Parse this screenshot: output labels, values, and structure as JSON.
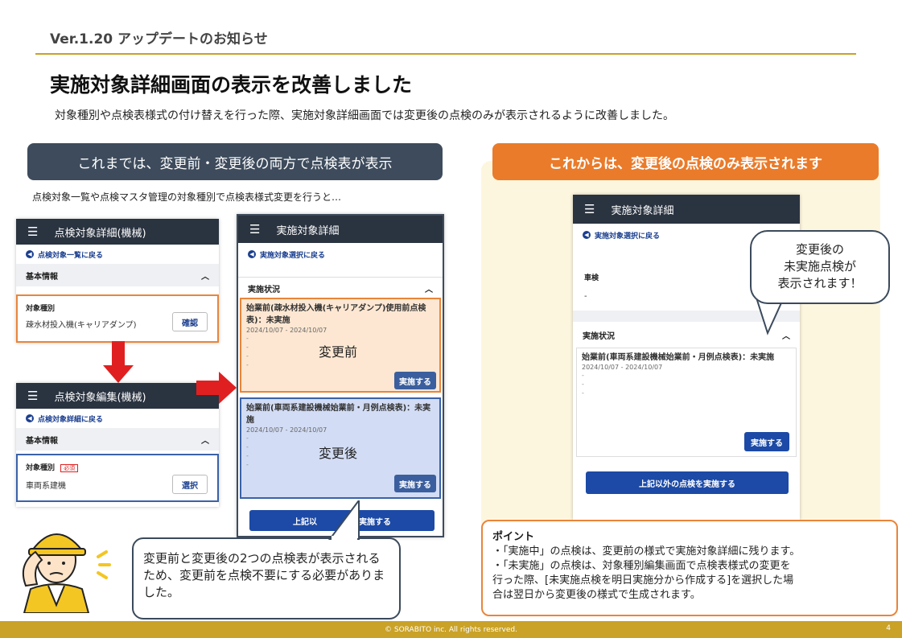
{
  "header": {
    "version": "Ver.1.20 アップデートのお知らせ",
    "title": "実施対象詳細画面の表示を改善しました",
    "subtitle": "対象種別や点検表様式の付け替えを行った際、実施対象詳細画面では変更後の点検のみが表示されるように改善しました。"
  },
  "left": {
    "header": "これまでは、変更前・変更後の両方で点検表が表示",
    "desc": "点検対象一覧や点検マスタ管理の対象種別で点検表様式変更を行うと…",
    "screen1": {
      "app_title": "点検対象詳細(機械)",
      "back": "点検対象一覧に戻る",
      "section": "基本情報",
      "field_label": "対象種別",
      "field_value": "疎水材投入機(キャリアダンプ)",
      "button": "確認"
    },
    "screen2": {
      "app_title": "点検対象編集(機械)",
      "back": "点検対象詳細に戻る",
      "section": "基本情報",
      "field_label": "対象種別",
      "required": "必須",
      "field_value": "車両系建機",
      "button": "選択"
    },
    "screen3": {
      "app_title": "実施対象詳細",
      "back": "実施対象選択に戻る",
      "section": "実施状況",
      "card1_text": "始業前(疎水材投入機(キャリアダンプ)使用前点検表)：未実施",
      "card1_date": "2024/10/07 - 2024/10/07",
      "card1_label": "変更前",
      "card1_button": "実施する",
      "card2_text": "始業前(車両系建設機械始業前・月例点検表)：未実施",
      "card2_date": "2024/10/07 - 2024/10/07",
      "card2_label": "変更後",
      "card2_button": "実施する",
      "bottom_button_left": "上記以",
      "bottom_button_right": "実施する"
    },
    "bubble": "変更前と変更後の2つの点検表が表示されるため、変更前を点検不要にする必要がありました。"
  },
  "right": {
    "header": "これからは、変更後の点検のみ表示されます",
    "screen": {
      "app_title": "実施対象詳細",
      "back": "実施対象選択に戻る",
      "field_label": "車検",
      "field_value": "-",
      "section": "実施状況",
      "card_text": "始業前(車両系建設機械始業前・月例点検表)：未実施",
      "card_date": "2024/10/07 - 2024/10/07",
      "card_button": "実施する",
      "bottom_button": "上記以外の点検を実施する"
    },
    "bubble_line1": "変更後の",
    "bubble_line2": "未実施点検が",
    "bubble_line3": "表示されます！",
    "point_title": "ポイント",
    "point_line1": "・「実施中」の点検は、変更前の様式で実施対象詳細に残ります。",
    "point_line2": "・「未実施」の点検は、対象種別編集画面で点検表様式の変更を",
    "point_line3": "行った際、[未実施点検を明日実施分から作成する]を選択した場",
    "point_line4": "合は翌日から変更後の様式で生成されます。"
  },
  "footer": {
    "copyright": "© SORABITO inc. All rights reserved.",
    "page": "4"
  },
  "colors": {
    "gold": "#c9a227",
    "navy": "#3d4b5c",
    "orange": "#ea7b2a",
    "app_bar": "#2a3340",
    "primary_button": "#1c4aa6",
    "arrow_red": "#e02020"
  }
}
